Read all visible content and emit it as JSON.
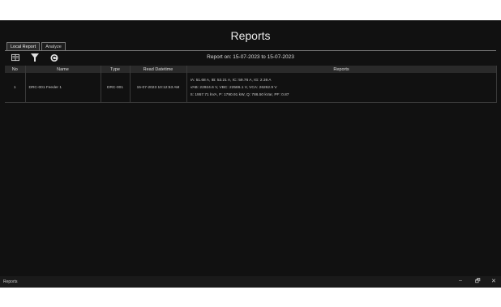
{
  "window": {
    "title": "Reports",
    "taskbar_label": "Reports"
  },
  "tabs": [
    {
      "label": "Local Report"
    },
    {
      "label": "Analyze"
    }
  ],
  "toolbar": {
    "icons": [
      "export-icon",
      "filter-icon",
      "refresh-icon"
    ]
  },
  "report_range": "Report on: 15-07-2023 to 15-07-2023",
  "table": {
    "headers": [
      "No",
      "Name",
      "Type",
      "Read Datetime",
      "Reports"
    ],
    "rows": [
      {
        "no": "1",
        "name": "DRC-001 Feeder 1",
        "type": "DRC-001",
        "datetime": "15-07-2023 10:12:53 AM",
        "reports": [
          "IA: 51.68 A, IB: 53.21 A, IC: 59.76 A, IG: 2.36 A",
          "VAB: 22924.6 V, VBC: 22586.1 V, VCA: 26262.9 V",
          "S: 1957.71 kVA, P: 1790.91 kW, Q: 786.50 kVar, PF: 0.87"
        ]
      }
    ]
  },
  "controls": {
    "minimize": "–",
    "restore": "🗗",
    "close": "✕"
  }
}
